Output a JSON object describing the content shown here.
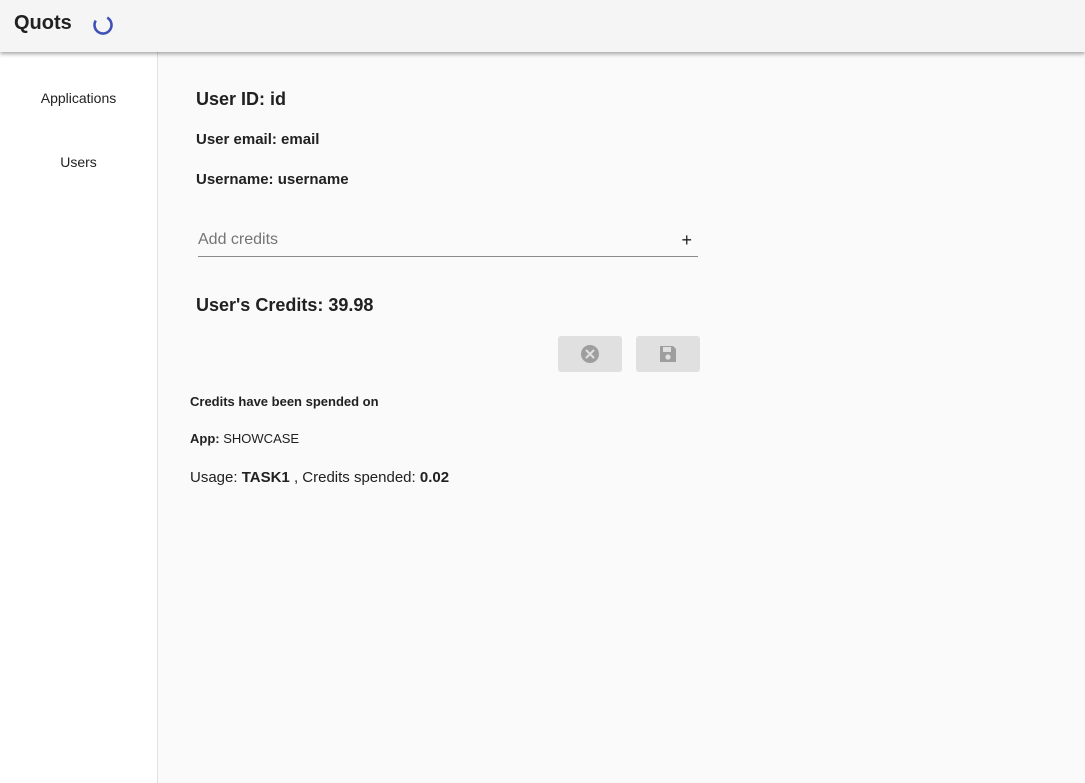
{
  "app": {
    "title": "Quots",
    "spinner_icon": "loading-spinner-icon",
    "accent_color": "#3f51b5"
  },
  "sidebar": {
    "items": [
      {
        "label": "Applications"
      },
      {
        "label": "Users"
      }
    ]
  },
  "user": {
    "id_heading": "User ID: id",
    "email_heading": "User email: email",
    "username_heading": "Username: username",
    "credits_heading": "User's Credits: 39.98"
  },
  "add_credits": {
    "placeholder": "Add credits",
    "value": "",
    "add_icon": "plus-icon"
  },
  "actions": {
    "cancel_icon": "cancel-circle-icon",
    "save_icon": "save-floppy-icon"
  },
  "spending": {
    "title": "Credits have been spended on",
    "app_label": "App:",
    "app_name": "SHOWCASE",
    "usage_label": "Usage:",
    "usage_name": "TASK1",
    "credits_label": ", Credits spended:",
    "credits_value": "0.02"
  }
}
